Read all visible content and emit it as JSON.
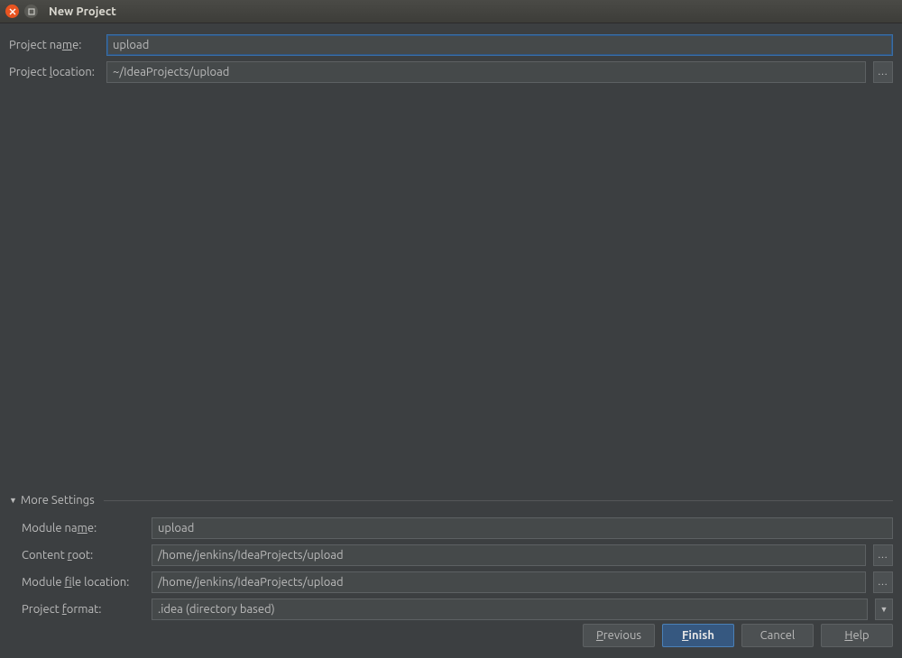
{
  "window": {
    "title": "New Project"
  },
  "form": {
    "project_name_label": "Project name:",
    "project_name_value": "upload",
    "project_location_label": "Project location:",
    "project_location_value": "~/IdeaProjects/upload"
  },
  "more": {
    "header": "More Settings",
    "module_name_label": "Module name:",
    "module_name_value": "upload",
    "content_root_label": "Content root:",
    "content_root_value": "/home/jenkins/IdeaProjects/upload",
    "module_file_label": "Module file location:",
    "module_file_value": "/home/jenkins/IdeaProjects/upload",
    "project_format_label": "Project format:",
    "project_format_value": ".idea (directory based)"
  },
  "buttons": {
    "previous": "Previous",
    "finish": "Finish",
    "cancel": "Cancel",
    "help": "Help"
  },
  "mnemonics": {
    "n": "n",
    "l": "l",
    "m": "m",
    "r": "r",
    "f1": "f",
    "f2": "f",
    "P": "P",
    "F": "F",
    "H": "H"
  }
}
